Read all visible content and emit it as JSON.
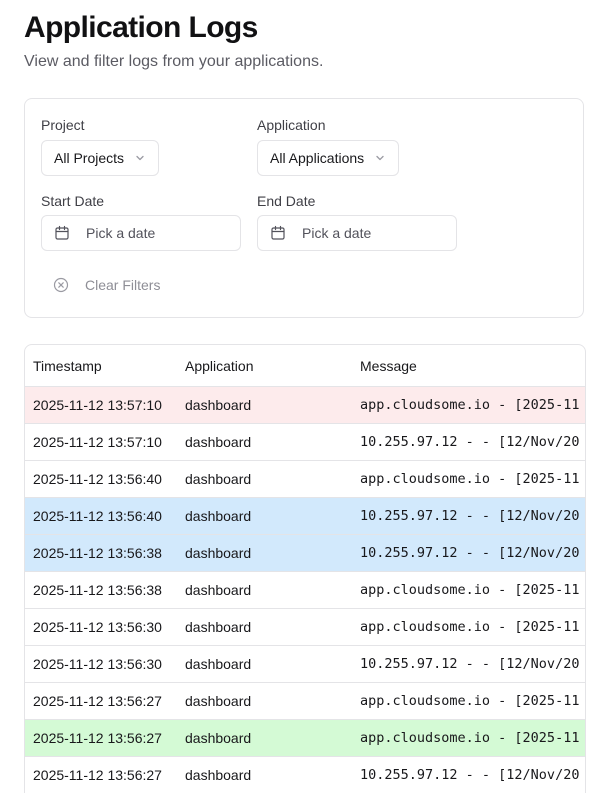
{
  "header": {
    "title": "Application Logs",
    "subtitle": "View and filter logs from your applications."
  },
  "filters": {
    "project_label": "Project",
    "project_value": "All Projects",
    "application_label": "Application",
    "application_value": "All Applications",
    "start_date_label": "Start Date",
    "start_date_placeholder": "Pick a date",
    "end_date_label": "End Date",
    "end_date_placeholder": "Pick a date",
    "clear_label": "Clear Filters"
  },
  "table": {
    "columns": [
      "Timestamp",
      "Application",
      "Message"
    ],
    "rows": [
      {
        "timestamp": "2025-11-12 13:57:10",
        "application": "dashboard",
        "message": "app.cloudsome.io - [2025-11",
        "highlight": "error"
      },
      {
        "timestamp": "2025-11-12 13:57:10",
        "application": "dashboard",
        "message": "10.255.97.12 - - [12/Nov/20",
        "highlight": "none"
      },
      {
        "timestamp": "2025-11-12 13:56:40",
        "application": "dashboard",
        "message": "app.cloudsome.io - [2025-11",
        "highlight": "none"
      },
      {
        "timestamp": "2025-11-12 13:56:40",
        "application": "dashboard",
        "message": "10.255.97.12 - - [12/Nov/20",
        "highlight": "info"
      },
      {
        "timestamp": "2025-11-12 13:56:38",
        "application": "dashboard",
        "message": "10.255.97.12 - - [12/Nov/20",
        "highlight": "info"
      },
      {
        "timestamp": "2025-11-12 13:56:38",
        "application": "dashboard",
        "message": "app.cloudsome.io - [2025-11",
        "highlight": "none"
      },
      {
        "timestamp": "2025-11-12 13:56:30",
        "application": "dashboard",
        "message": "app.cloudsome.io - [2025-11",
        "highlight": "none"
      },
      {
        "timestamp": "2025-11-12 13:56:30",
        "application": "dashboard",
        "message": "10.255.97.12 - - [12/Nov/20",
        "highlight": "none"
      },
      {
        "timestamp": "2025-11-12 13:56:27",
        "application": "dashboard",
        "message": "app.cloudsome.io - [2025-11",
        "highlight": "none"
      },
      {
        "timestamp": "2025-11-12 13:56:27",
        "application": "dashboard",
        "message": "app.cloudsome.io - [2025-11",
        "highlight": "success"
      },
      {
        "timestamp": "2025-11-12 13:56:27",
        "application": "dashboard",
        "message": "10.255.97.12 - - [12/Nov/20",
        "highlight": "none"
      }
    ]
  },
  "icons": {
    "select_chevron": "chevron-down-icon",
    "date_picker": "calendar-icon",
    "clear_filters": "circle-x-icon"
  },
  "colors": {
    "error_row": "#fdebec",
    "info_row": "#d2e9fc",
    "success_row": "#d4fad5",
    "border": "#e4e4e7"
  }
}
